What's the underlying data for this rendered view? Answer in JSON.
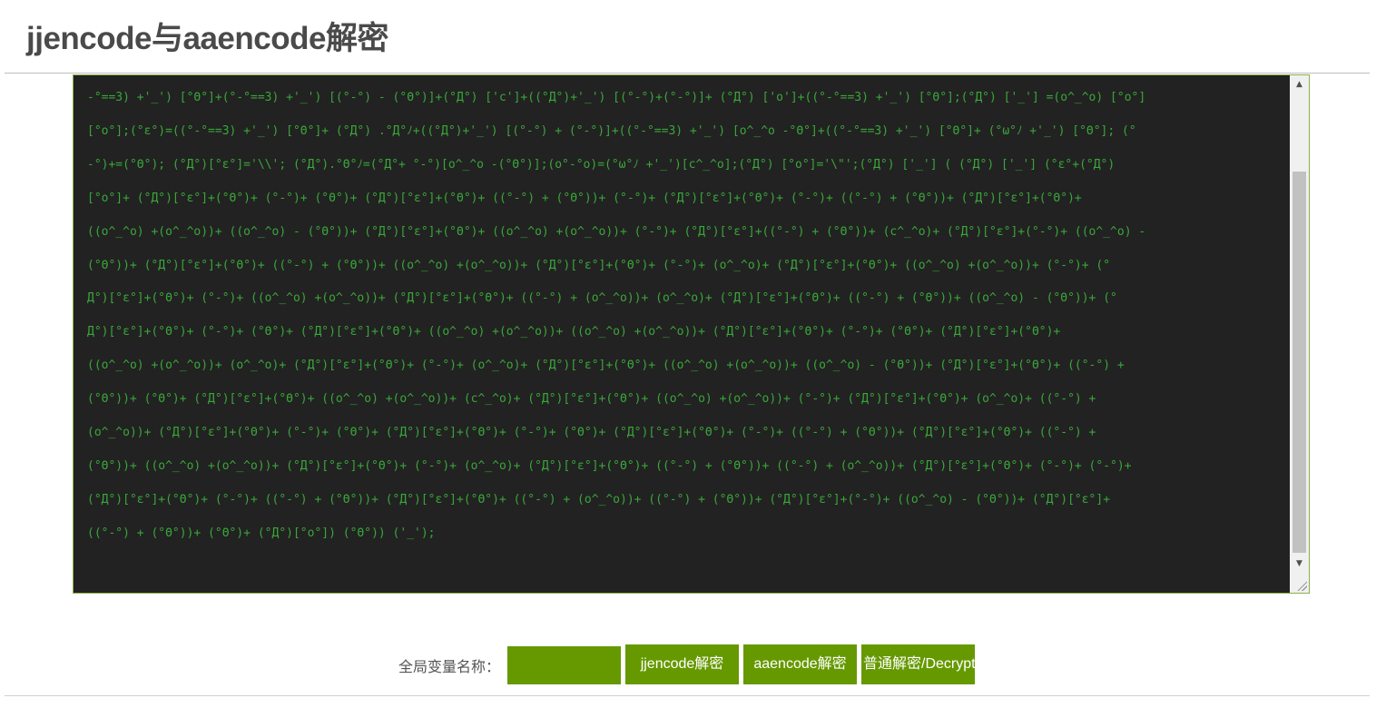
{
  "page": {
    "title": "jjencode与aaencode解密"
  },
  "code": {
    "lines": [
      "-°==3) +'_') [°Θ°]+(°-°==3) +'_') [(°-°) - (°Θ°)]+(°Д°) ['c']+((°Д°)+'_') [(°-°)+(°-°)]+ (°Д°) ['o']+((°-°==3) +'_') [°Θ°];(°Д°) ['_'] =(o^_^o) [°o°]",
      "[°o°];(°ε°)=((°-°==3) +'_') [°Θ°]+ (°Д°) .°Д°ﾉ+((°Д°)+'_') [(°-°) + (°-°)]+((°-°==3) +'_') [o^_^o -°Θ°]+((°-°==3) +'_') [°Θ°]+ (°ω°ﾉ +'_') [°Θ°]; (°",
      "-°)+=(°Θ°); (°Д°)[°ε°]='\\\\'; (°Д°).°Θ°ﾉ=(°Д°+ °-°)[o^_^o -(°Θ°)];(o°-°o)=(°ω°ﾉ +'_')[c^_^o];(°Д°) [°o°]='\\\"';(°Д°) ['_'] ( (°Д°) ['_'] (°ε°+(°Д°)",
      "[°o°]+ (°Д°)[°ε°]+(°Θ°)+ (°-°)+ (°Θ°)+ (°Д°)[°ε°]+(°Θ°)+ ((°-°) + (°Θ°))+ (°-°)+ (°Д°)[°ε°]+(°Θ°)+ (°-°)+ ((°-°) + (°Θ°))+ (°Д°)[°ε°]+(°Θ°)+",
      "((o^_^o) +(o^_^o))+ ((o^_^o) - (°Θ°))+ (°Д°)[°ε°]+(°Θ°)+ ((o^_^o) +(o^_^o))+ (°-°)+ (°Д°)[°ε°]+((°-°) + (°Θ°))+ (c^_^o)+ (°Д°)[°ε°]+(°-°)+ ((o^_^o) -",
      "(°Θ°))+ (°Д°)[°ε°]+(°Θ°)+ ((°-°) + (°Θ°))+ ((o^_^o) +(o^_^o))+ (°Д°)[°ε°]+(°Θ°)+ (°-°)+ (o^_^o)+ (°Д°)[°ε°]+(°Θ°)+ ((o^_^o) +(o^_^o))+ (°-°)+ (°",
      "Д°)[°ε°]+(°Θ°)+ (°-°)+ ((o^_^o) +(o^_^o))+ (°Д°)[°ε°]+(°Θ°)+ ((°-°) + (o^_^o))+ (o^_^o)+ (°Д°)[°ε°]+(°Θ°)+ ((°-°) + (°Θ°))+ ((o^_^o) - (°Θ°))+ (°",
      "Д°)[°ε°]+(°Θ°)+ (°-°)+ (°Θ°)+ (°Д°)[°ε°]+(°Θ°)+ ((o^_^o) +(o^_^o))+ ((o^_^o) +(o^_^o))+ (°Д°)[°ε°]+(°Θ°)+ (°-°)+ (°Θ°)+ (°Д°)[°ε°]+(°Θ°)+",
      "((o^_^o) +(o^_^o))+ (o^_^o)+ (°Д°)[°ε°]+(°Θ°)+ (°-°)+ (o^_^o)+ (°Д°)[°ε°]+(°Θ°)+ ((o^_^o) +(o^_^o))+ ((o^_^o) - (°Θ°))+ (°Д°)[°ε°]+(°Θ°)+ ((°-°) +",
      "(°Θ°))+ (°Θ°)+ (°Д°)[°ε°]+(°Θ°)+ ((o^_^o) +(o^_^o))+ (c^_^o)+ (°Д°)[°ε°]+(°Θ°)+ ((o^_^o) +(o^_^o))+ (°-°)+ (°Д°)[°ε°]+(°Θ°)+ (o^_^o)+ ((°-°) +",
      "(o^_^o))+ (°Д°)[°ε°]+(°Θ°)+ (°-°)+ (°Θ°)+ (°Д°)[°ε°]+(°Θ°)+ (°-°)+ (°Θ°)+ (°Д°)[°ε°]+(°Θ°)+ (°-°)+ ((°-°) + (°Θ°))+ (°Д°)[°ε°]+(°Θ°)+ ((°-°) +",
      "(°Θ°))+ ((o^_^o) +(o^_^o))+ (°Д°)[°ε°]+(°Θ°)+ (°-°)+ (o^_^o)+ (°Д°)[°ε°]+(°Θ°)+ ((°-°) + (°Θ°))+ ((°-°) + (o^_^o))+ (°Д°)[°ε°]+(°Θ°)+ (°-°)+ (°-°)+",
      "(°Д°)[°ε°]+(°Θ°)+ (°-°)+ ((°-°) + (°Θ°))+ (°Д°)[°ε°]+(°Θ°)+ ((°-°) + (o^_^o))+ ((°-°) + (°Θ°))+ (°Д°)[°ε°]+(°-°)+ ((o^_^o) - (°Θ°))+ (°Д°)[°ε°]+",
      "((°-°) + (°Θ°))+ (°Θ°)+ (°Д°)[°o°]) (°Θ°)) ('_');"
    ]
  },
  "controls": {
    "var_label": "全局变量名称：",
    "var_value": "",
    "jj_button": "jjencode解密",
    "aa_button": "aaencode解密",
    "normal_button": "普通解密/Decrypt"
  },
  "colors": {
    "accent": "#669900",
    "code_bg": "#222222",
    "code_text": "#3aa63a",
    "title": "#4a4a4a"
  },
  "icons": {
    "scroll_up": "triangle-up",
    "scroll_down": "triangle-down",
    "resize": "resize-grip"
  }
}
